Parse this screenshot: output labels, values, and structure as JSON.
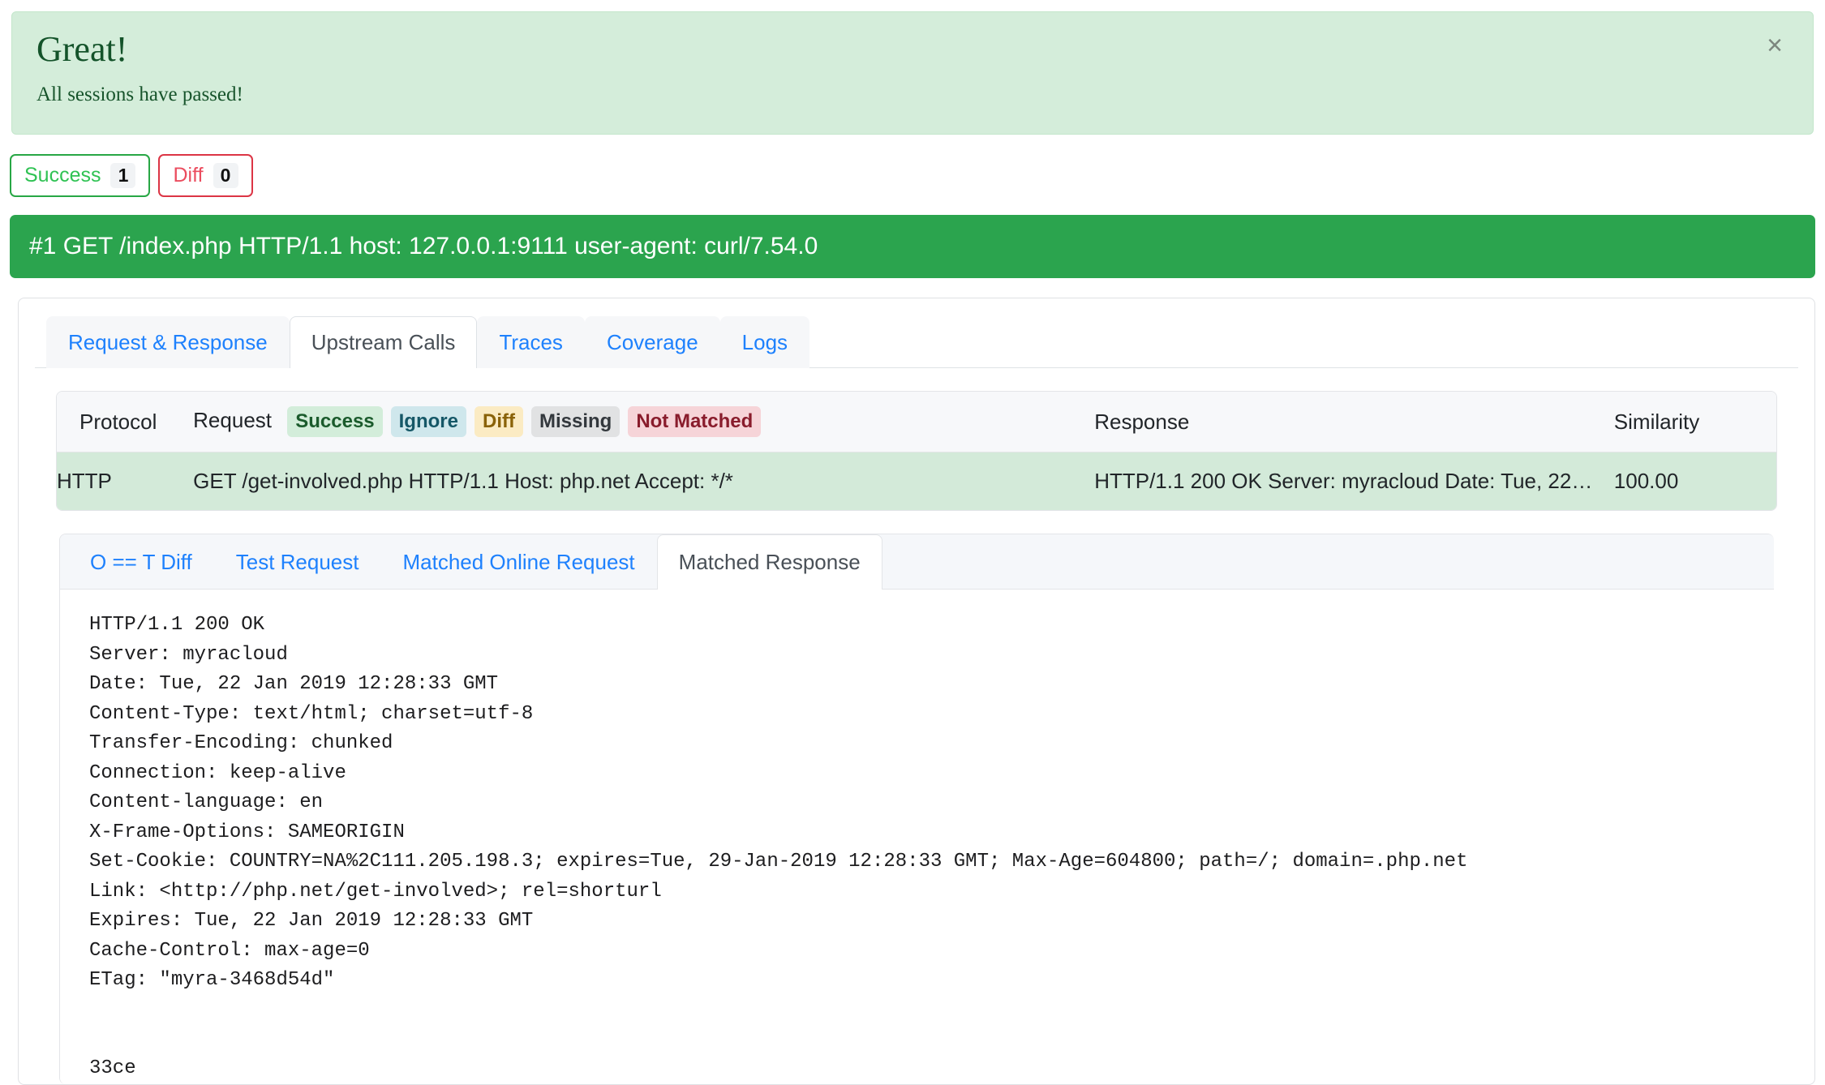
{
  "alert": {
    "heading": "Great!",
    "message": "All sessions have passed!",
    "close_icon": "×",
    "bg_color": "#d4edda",
    "text_color": "#155724"
  },
  "filters": [
    {
      "label": "Success",
      "count": "1",
      "accent": "#28a745"
    },
    {
      "label": "Diff",
      "count": "0",
      "accent": "#dc3545"
    }
  ],
  "session": {
    "title": "#1 GET /index.php HTTP/1.1 host: 127.0.0.1:9111 user-agent: curl/7.54.0",
    "bg_color": "#2ba44e"
  },
  "tabs": [
    {
      "label": "Request & Response",
      "active": false
    },
    {
      "label": "Upstream Calls",
      "active": true
    },
    {
      "label": "Traces",
      "active": false
    },
    {
      "label": "Coverage",
      "active": false
    },
    {
      "label": "Logs",
      "active": false
    }
  ],
  "table": {
    "headers": {
      "protocol": "Protocol",
      "request": "Request",
      "response": "Response",
      "similarity": "Similarity"
    },
    "status_badges": [
      {
        "label": "Success",
        "class": "b-success"
      },
      {
        "label": "Ignore",
        "class": "b-ignore"
      },
      {
        "label": "Diff",
        "class": "b-diff"
      },
      {
        "label": "Missing",
        "class": "b-missing"
      },
      {
        "label": "Not Matched",
        "class": "b-notmatched"
      }
    ],
    "rows": [
      {
        "protocol": "HTTP",
        "request": "GET /get-involved.php HTTP/1.1 Host: php.net Accept: */*",
        "response": "HTTP/1.1 200 OK Server: myracloud Date: Tue, 22…",
        "similarity": "100.00",
        "status": "success"
      }
    ]
  },
  "subtabs": [
    {
      "label": "O == T Diff",
      "active": false
    },
    {
      "label": "Test Request",
      "active": false
    },
    {
      "label": "Matched Online Request",
      "active": false
    },
    {
      "label": "Matched Response",
      "active": true
    }
  ],
  "matched_response_body": "HTTP/1.1 200 OK\nServer: myracloud\nDate: Tue, 22 Jan 2019 12:28:33 GMT\nContent-Type: text/html; charset=utf-8\nTransfer-Encoding: chunked\nConnection: keep-alive\nContent-language: en\nX-Frame-Options: SAMEORIGIN\nSet-Cookie: COUNTRY=NA%2C111.205.198.3; expires=Tue, 29-Jan-2019 12:28:33 GMT; Max-Age=604800; path=/; domain=.php.net\nLink: <http://php.net/get-involved>; rel=shorturl\nExpires: Tue, 22 Jan 2019 12:28:33 GMT\nCache-Control: max-age=0\nETag: \"myra-3468d54d\"\n\n\n33ce"
}
